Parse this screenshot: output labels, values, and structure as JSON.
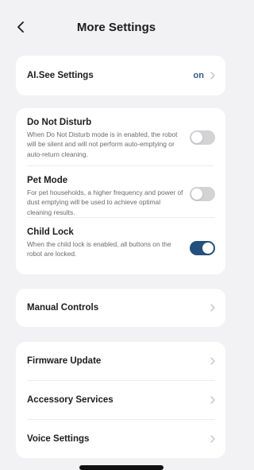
{
  "header": {
    "title": "More Settings",
    "back_icon": "chevron-left-icon"
  },
  "aisee": {
    "label": "AI.See Settings",
    "value": "on"
  },
  "toggles": [
    {
      "title": "Do Not Disturb",
      "description": "When Do Not Disturb mode is in enabled, the robot will be silent and will not perform auto-emptying or auto-return cleaning.",
      "state": "off"
    },
    {
      "title": "Pet Mode",
      "description": "For pet households, a higher frequency and power of dust emptying will be used to achieve optimal cleaning results.",
      "state": "off"
    },
    {
      "title": "Child Lock",
      "description": "When the child lock is enabled, all buttons on the robot are locked.",
      "state": "on"
    }
  ],
  "manual": {
    "label": "Manual Controls"
  },
  "more_items": [
    {
      "label": "Firmware Update"
    },
    {
      "label": "Accessory Services"
    },
    {
      "label": "Voice Settings"
    }
  ],
  "colors": {
    "background": "#f2f2f4",
    "card": "#ffffff",
    "accent": "#24507d",
    "toggle_off": "#d3d3d6"
  }
}
